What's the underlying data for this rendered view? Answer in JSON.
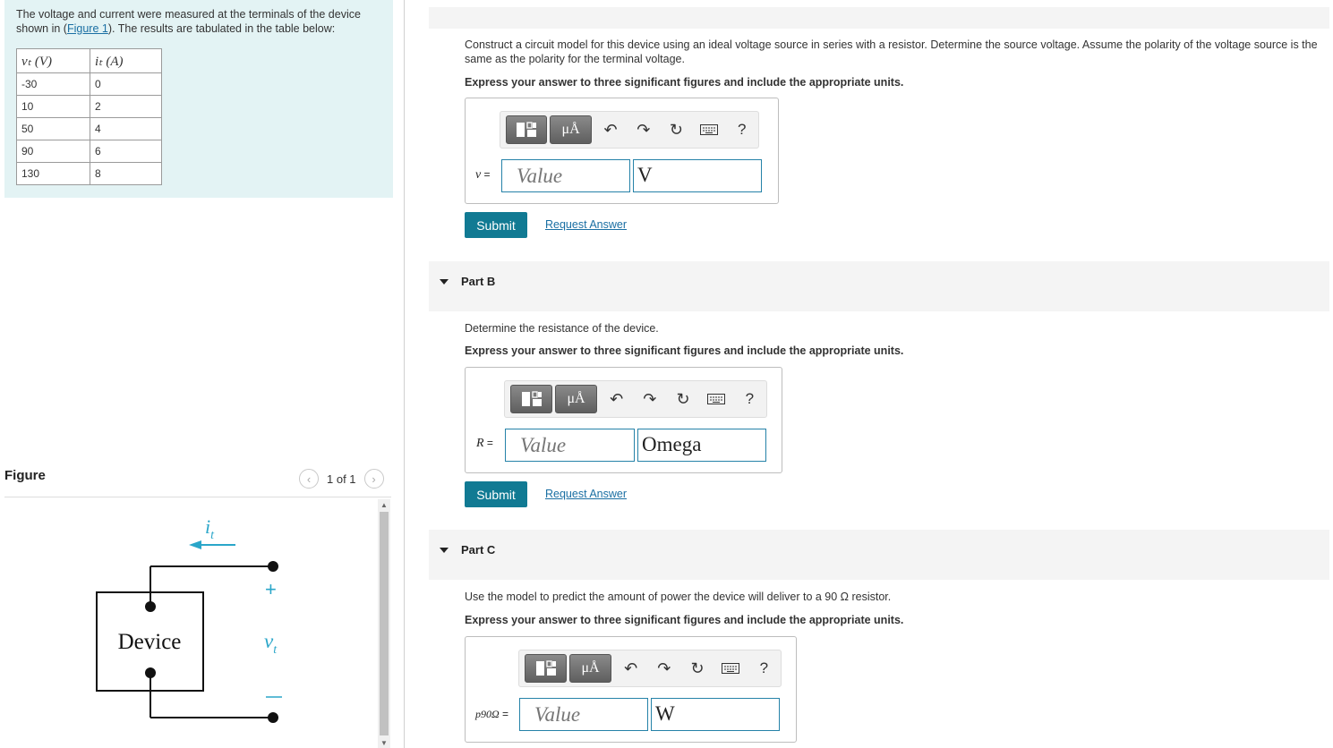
{
  "intro": {
    "text_before_link": "The voltage and current were measured at the terminals of the device shown in (",
    "link": "Figure 1",
    "text_after_link": "). The results are tabulated in the table below:"
  },
  "table": {
    "headers": [
      "vₜ (V)",
      "iₜ (A)"
    ],
    "rows": [
      [
        "-30",
        "0"
      ],
      [
        "10",
        "2"
      ],
      [
        "50",
        "4"
      ],
      [
        "90",
        "6"
      ],
      [
        "130",
        "8"
      ]
    ]
  },
  "figure": {
    "title": "Figure",
    "count": "1 of 1",
    "current_label": "i",
    "current_sub": "t",
    "device_label": "Device",
    "plus": "+",
    "minus": "−",
    "voltage_label": "v",
    "voltage_sub": "t",
    "accent_color": "#2aa6c9"
  },
  "part_a": {
    "question": "Construct a circuit model for this device using an ideal voltage source in series with a resistor. Determine the source voltage. Assume the polarity of the voltage source is the same as the polarity for the terminal voltage.",
    "instruction": "Express your answer to three significant figures and include the appropriate units.",
    "var": "v",
    "eq": " =",
    "placeholder": "Value",
    "unit": "V",
    "submit": "Submit",
    "request": "Request Answer"
  },
  "part_b": {
    "header": "Part B",
    "question": "Determine the resistance of the device.",
    "instruction": "Express your answer to three significant figures and include the appropriate units.",
    "var": "R",
    "eq": " =",
    "placeholder": "Value",
    "unit": "Omega",
    "submit": "Submit",
    "request": "Request Answer"
  },
  "part_c": {
    "header": "Part C",
    "question": "Use the model to predict the amount of power the device will deliver to a 90 Ω resistor.",
    "instruction": "Express your answer to three significant figures and include the appropriate units.",
    "var": "p90Ω",
    "eq": " =",
    "placeholder": "Value",
    "unit": "W"
  },
  "toolbar": {
    "units_btn": "μÅ",
    "help": "?"
  },
  "colors": {
    "submit_bg": "#117a93",
    "input_border": "#2582a8",
    "intro_bg": "#e3f3f4"
  }
}
